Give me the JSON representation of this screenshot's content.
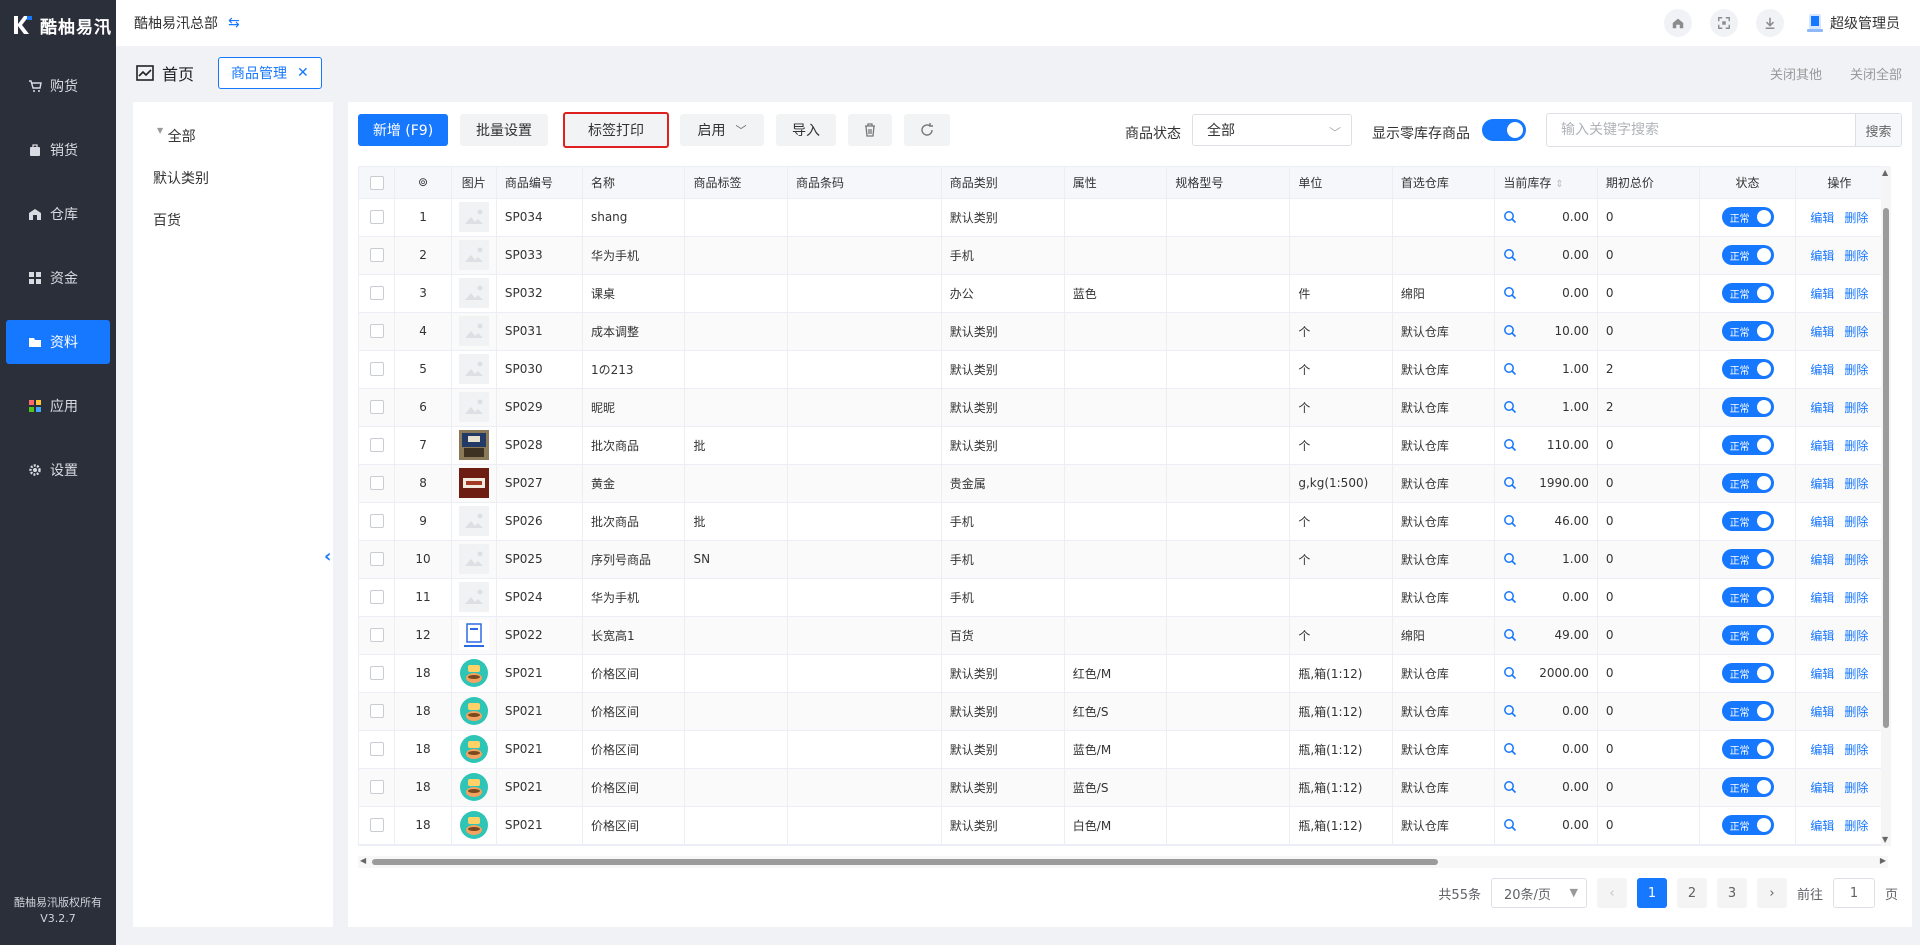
{
  "app": {
    "logo_text": "酷柚易汛",
    "copyright": "酷柚易汛版权所有",
    "version": "V3.2.7",
    "org": "酷柚易汛总部",
    "user": "超级管理员"
  },
  "nav": [
    {
      "label": "购货",
      "icon": "cart-icon"
    },
    {
      "label": "销货",
      "icon": "bag-icon"
    },
    {
      "label": "仓库",
      "icon": "warehouse-icon"
    },
    {
      "label": "资金",
      "icon": "grid-icon"
    },
    {
      "label": "资料",
      "icon": "folder-icon",
      "active": true
    },
    {
      "label": "应用",
      "icon": "apps-icon"
    },
    {
      "label": "设置",
      "icon": "gear-icon"
    }
  ],
  "tabs": {
    "home": "首页",
    "current": "商品管理",
    "close_others": "关闭其他",
    "close_all": "关闭全部"
  },
  "categories": {
    "all": "全部",
    "items": [
      "默认类别",
      "百货"
    ]
  },
  "toolbar": {
    "add": "新增 (F9)",
    "batch": "批量设置",
    "print": "标签打印",
    "enable": "启用",
    "import": "导入",
    "status_label": "商品状态",
    "status_value": "全部",
    "zero_label": "显示零库存商品",
    "search_placeholder": "输入关键字搜索",
    "search_btn": "搜索"
  },
  "columns": [
    "图片",
    "商品编号",
    "名称",
    "商品标签",
    "商品条码",
    "商品类别",
    "属性",
    "规格型号",
    "单位",
    "首选仓库",
    "当前库存",
    "期初总价",
    "状态",
    "操作"
  ],
  "rows": [
    {
      "no": "1",
      "img": "placeholder",
      "code": "SP034",
      "name": "shang",
      "tag": "",
      "barcode": "",
      "cat": "默认类别",
      "attr": "",
      "spec": "",
      "unit": "",
      "wh": "",
      "stock": "0.00",
      "init": "0",
      "status": "正常"
    },
    {
      "no": "2",
      "img": "placeholder",
      "code": "SP033",
      "name": "华为手机",
      "tag": "",
      "barcode": "",
      "cat": "手机",
      "attr": "",
      "spec": "",
      "unit": "",
      "wh": "",
      "stock": "0.00",
      "init": "0",
      "status": "正常"
    },
    {
      "no": "3",
      "img": "placeholder",
      "code": "SP032",
      "name": "课桌",
      "tag": "",
      "barcode": "",
      "cat": "办公",
      "attr": "蓝色",
      "spec": "",
      "unit": "件",
      "wh": "绵阳",
      "stock": "0.00",
      "init": "0",
      "status": "正常"
    },
    {
      "no": "4",
      "img": "placeholder",
      "code": "SP031",
      "name": "成本调整",
      "tag": "",
      "barcode": "",
      "cat": "默认类别",
      "attr": "",
      "spec": "",
      "unit": "个",
      "wh": "默认仓库",
      "stock": "10.00",
      "init": "0",
      "status": "正常"
    },
    {
      "no": "5",
      "img": "placeholder",
      "code": "SP030",
      "name": "1の213",
      "tag": "",
      "barcode": "",
      "cat": "默认类别",
      "attr": "",
      "spec": "",
      "unit": "个",
      "wh": "默认仓库",
      "stock": "1.00",
      "init": "2",
      "status": "正常"
    },
    {
      "no": "6",
      "img": "placeholder",
      "code": "SP029",
      "name": "昵昵",
      "tag": "",
      "barcode": "",
      "cat": "默认类别",
      "attr": "",
      "spec": "",
      "unit": "个",
      "wh": "默认仓库",
      "stock": "1.00",
      "init": "2",
      "status": "正常"
    },
    {
      "no": "7",
      "img": "photo-dark",
      "code": "SP028",
      "name": "批次商品",
      "tag": "批",
      "barcode": "",
      "cat": "默认类别",
      "attr": "",
      "spec": "",
      "unit": "个",
      "wh": "默认仓库",
      "stock": "110.00",
      "init": "0",
      "status": "正常"
    },
    {
      "no": "8",
      "img": "photo-red",
      "code": "SP027",
      "name": "黄金",
      "tag": "",
      "barcode": "",
      "cat": "贵金属",
      "attr": "",
      "spec": "",
      "unit": "g,kg(1:500)",
      "wh": "默认仓库",
      "stock": "1990.00",
      "init": "0",
      "status": "正常"
    },
    {
      "no": "9",
      "img": "placeholder",
      "code": "SP026",
      "name": "批次商品",
      "tag": "批",
      "barcode": "",
      "cat": "手机",
      "attr": "",
      "spec": "",
      "unit": "个",
      "wh": "默认仓库",
      "stock": "46.00",
      "init": "0",
      "status": "正常"
    },
    {
      "no": "10",
      "img": "placeholder",
      "code": "SP025",
      "name": "序列号商品",
      "tag": "SN",
      "barcode": "",
      "cat": "手机",
      "attr": "",
      "spec": "",
      "unit": "个",
      "wh": "默认仓库",
      "stock": "1.00",
      "init": "0",
      "status": "正常"
    },
    {
      "no": "11",
      "img": "placeholder",
      "code": "SP024",
      "name": "华为手机",
      "tag": "",
      "barcode": "",
      "cat": "手机",
      "attr": "",
      "spec": "",
      "unit": "",
      "wh": "默认仓库",
      "stock": "0.00",
      "init": "0",
      "status": "正常"
    },
    {
      "no": "12",
      "img": "doc",
      "code": "SP022",
      "name": "长宽高1",
      "tag": "",
      "barcode": "",
      "cat": "百货",
      "attr": "",
      "spec": "",
      "unit": "个",
      "wh": "绵阳",
      "stock": "49.00",
      "init": "0",
      "status": "正常"
    },
    {
      "no": "18",
      "img": "food",
      "code": "SP021",
      "name": "价格区间",
      "tag": "",
      "barcode": "",
      "cat": "默认类别",
      "attr": "红色/M",
      "spec": "",
      "unit": "瓶,箱(1:12)",
      "wh": "默认仓库",
      "stock": "2000.00",
      "init": "0",
      "status": "正常"
    },
    {
      "no": "18",
      "img": "food",
      "code": "SP021",
      "name": "价格区间",
      "tag": "",
      "barcode": "",
      "cat": "默认类别",
      "attr": "红色/S",
      "spec": "",
      "unit": "瓶,箱(1:12)",
      "wh": "默认仓库",
      "stock": "0.00",
      "init": "0",
      "status": "正常"
    },
    {
      "no": "18",
      "img": "food",
      "code": "SP021",
      "name": "价格区间",
      "tag": "",
      "barcode": "",
      "cat": "默认类别",
      "attr": "蓝色/M",
      "spec": "",
      "unit": "瓶,箱(1:12)",
      "wh": "默认仓库",
      "stock": "0.00",
      "init": "0",
      "status": "正常"
    },
    {
      "no": "18",
      "img": "food",
      "code": "SP021",
      "name": "价格区间",
      "tag": "",
      "barcode": "",
      "cat": "默认类别",
      "attr": "蓝色/S",
      "spec": "",
      "unit": "瓶,箱(1:12)",
      "wh": "默认仓库",
      "stock": "0.00",
      "init": "0",
      "status": "正常"
    },
    {
      "no": "18",
      "img": "food",
      "code": "SP021",
      "name": "价格区间",
      "tag": "",
      "barcode": "",
      "cat": "默认类别",
      "attr": "白色/M",
      "spec": "",
      "unit": "瓶,箱(1:12)",
      "wh": "默认仓库",
      "stock": "0.00",
      "init": "0",
      "status": "正常"
    }
  ],
  "row_actions": {
    "edit": "编辑",
    "delete": "删除"
  },
  "pager": {
    "total": "共55条",
    "size": "20条/页",
    "pages": [
      "1",
      "2",
      "3"
    ],
    "goto": "前往",
    "page_value": "1",
    "page_suffix": "页"
  },
  "colors": {
    "accent": "#1677ff",
    "sidebar": "#2b2f3a",
    "highlight_border": "#e02020"
  }
}
